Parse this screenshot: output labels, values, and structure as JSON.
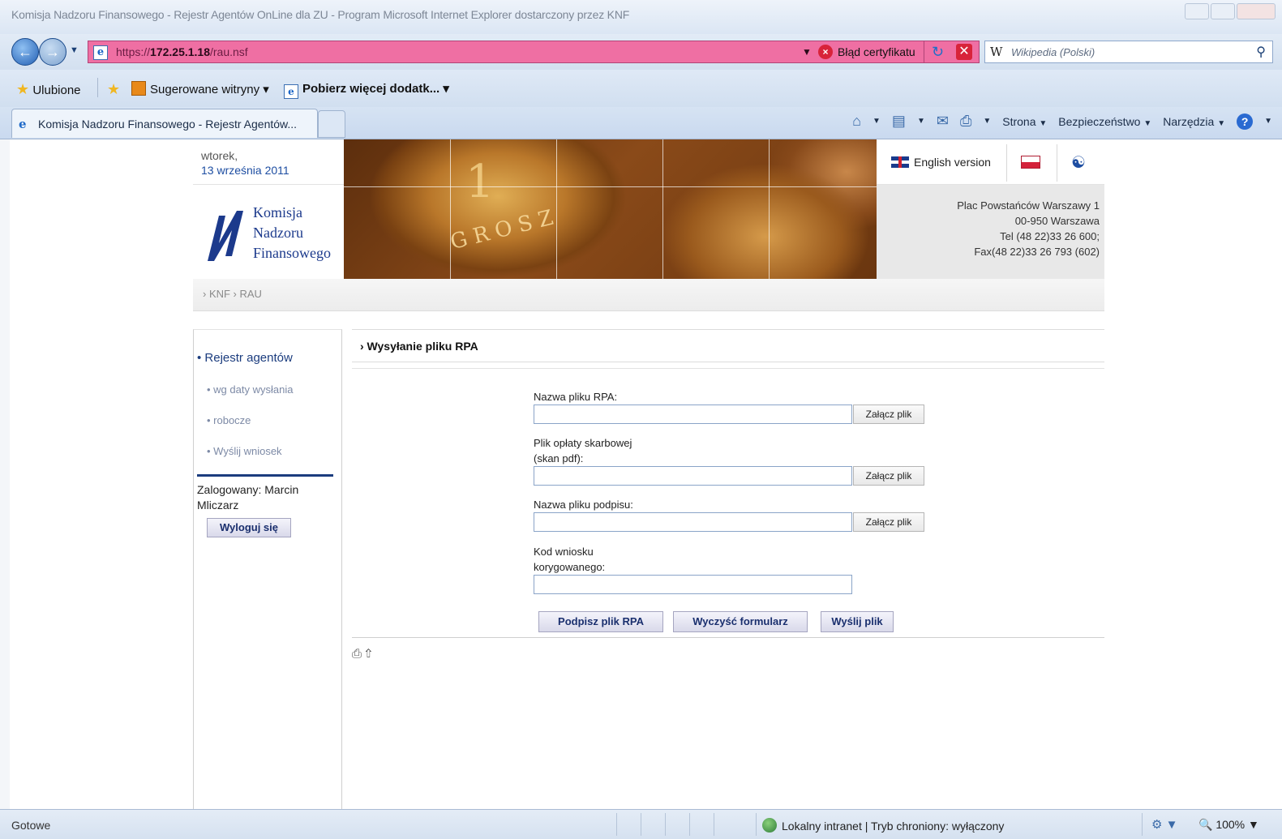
{
  "window": {
    "title": "Komisja Nadzoru Finansowego - Rejestr Agentów OnLine dla ZU - Program Microsoft Internet Explorer dostarczony przez KNF"
  },
  "address_bar": {
    "url_prefix": "https://",
    "url_host": "172.25.1.18",
    "url_path": "/rau.nsf",
    "cert_error": "Błąd certyfikatu",
    "background_color": "#ef6fa3"
  },
  "search": {
    "placeholder": "Wikipedia (Polski)",
    "logo": "W"
  },
  "favorites_bar": {
    "favorites": "Ulubione",
    "suggested": "Sugerowane witryny ▾",
    "addons": "Pobierz więcej dodatk... ▾"
  },
  "tab": {
    "label": "Komisja Nadzoru Finansowego - Rejestr Agentów..."
  },
  "command_bar": {
    "page": "Strona",
    "security": "Bezpieczeństwo",
    "tools": "Narzędzia"
  },
  "header": {
    "day": "wtorek,",
    "date": "13 września 2011",
    "logo_lines": [
      "Komisja",
      "Nadzoru",
      "Finansowego"
    ],
    "english_version": "English version",
    "address_lines": [
      "Plac Powstańców Warszawy 1",
      "00-950 Warszawa",
      "Tel (48 22)33 26 600;",
      "Fax(48 22)33 26 793 (602)"
    ]
  },
  "breadcrumb": "› KNF › RAU",
  "sidebar": {
    "heading": "• Rejestr agentów",
    "items": [
      "• wg daty wysłania",
      "• robocze",
      "• Wyślij wniosek"
    ],
    "logged_in": "Zalogowany: Marcin Mliczarz",
    "logout": "Wyloguj się"
  },
  "form": {
    "title": "› Wysyłanie pliku RPA",
    "rpa_label": "Nazwa pliku RPA:",
    "fee_label_1": "Plik opłaty skarbowej",
    "fee_label_2": "(skan pdf):",
    "signature_label": "Nazwa pliku podpisu:",
    "code_label_1": "Kod wniosku",
    "code_label_2": "korygowanego:",
    "rpa_value": "",
    "fee_value": "",
    "signature_value": "",
    "code_value": "",
    "attach": "Załącz plik",
    "sign_button": "Podpisz plik RPA",
    "clear_button": "Wyczyść formularz",
    "send_button": "Wyślij plik"
  },
  "status_bar": {
    "status": "Gotowe",
    "zone": "Lokalny intranet | Tryb chroniony: wyłączony",
    "zoom": "100%"
  },
  "icons": {
    "back": "back-arrow-icon",
    "forward": "forward-arrow-icon",
    "favorites": "star-icon",
    "home": "home-icon",
    "feeds": "rss-icon",
    "mail": "mail-icon",
    "print": "printer-icon",
    "help": "help-icon"
  }
}
